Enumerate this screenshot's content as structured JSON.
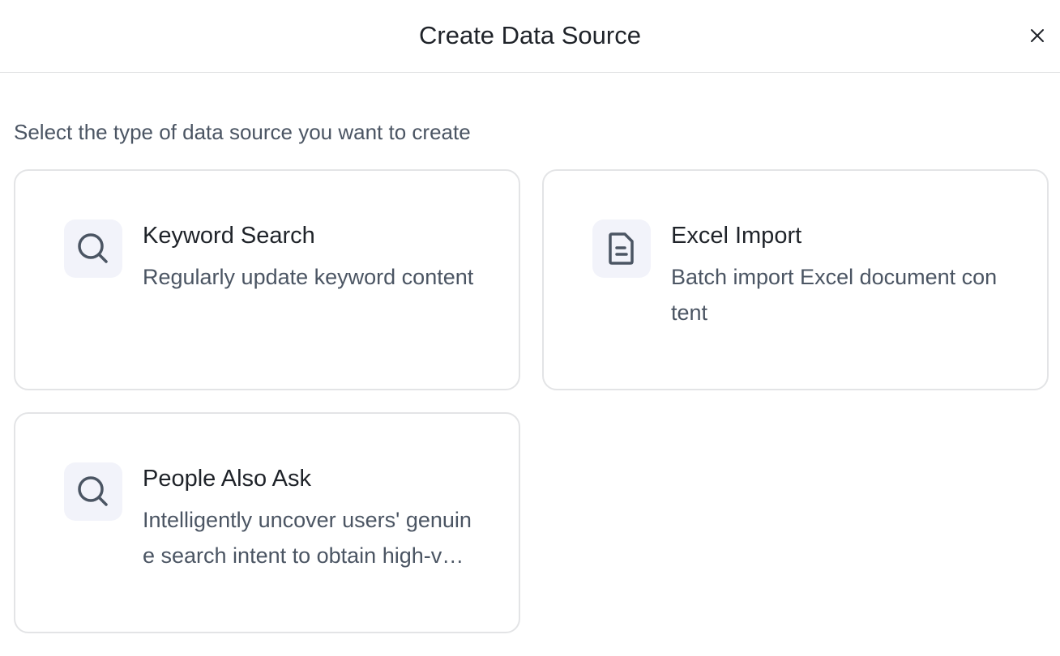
{
  "dialog": {
    "title": "Create Data Source",
    "close_icon": "close-icon",
    "subtitle": "Select the type of data source you want to create"
  },
  "cards": [
    {
      "icon": "search-icon",
      "title": "Keyword Search",
      "description": "Regularly update keyword content"
    },
    {
      "icon": "document-icon",
      "title": "Excel Import",
      "description": "Batch import Excel document content"
    },
    {
      "icon": "search-icon",
      "title": "People Also Ask",
      "description": "Intelligently uncover users' genuine search intent to obtain high-value questions"
    }
  ],
  "colors": {
    "icon_stroke": "#4b5563",
    "icon_bg": "#f2f3fa",
    "card_border": "#e3e4e6"
  }
}
